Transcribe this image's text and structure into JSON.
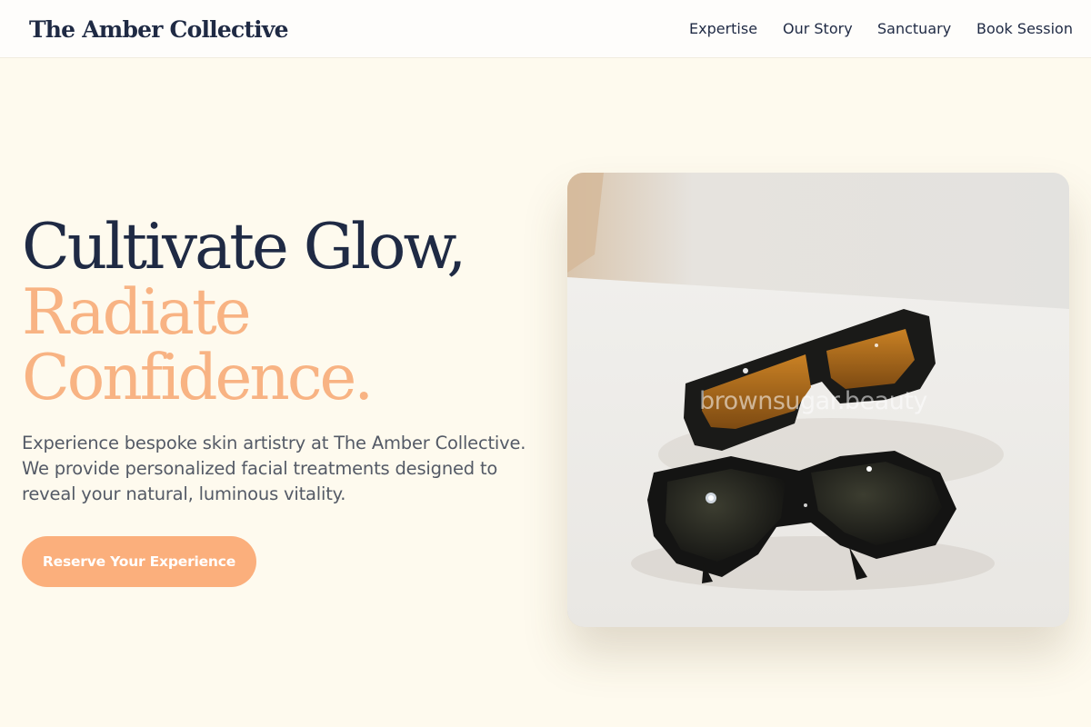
{
  "header": {
    "brand": "The Amber Collective",
    "nav": [
      "Expertise",
      "Our Story",
      "Sanctuary",
      "Book Session"
    ]
  },
  "hero": {
    "title_line1": "Cultivate Glow,",
    "title_line2": "Radiate",
    "title_line3": "Confidence.",
    "description": "Experience bespoke skin artistry at The Amber Collective. We provide personalized facial treatments designed to reveal your natural, luminous vitality.",
    "cta_label": "Reserve Your Experience",
    "image_watermark": "brownsugar.beauty"
  },
  "colors": {
    "background": "#fefaee",
    "navy": "#1f2a44",
    "accent": "#f8b383",
    "button": "#fbaf7c"
  }
}
